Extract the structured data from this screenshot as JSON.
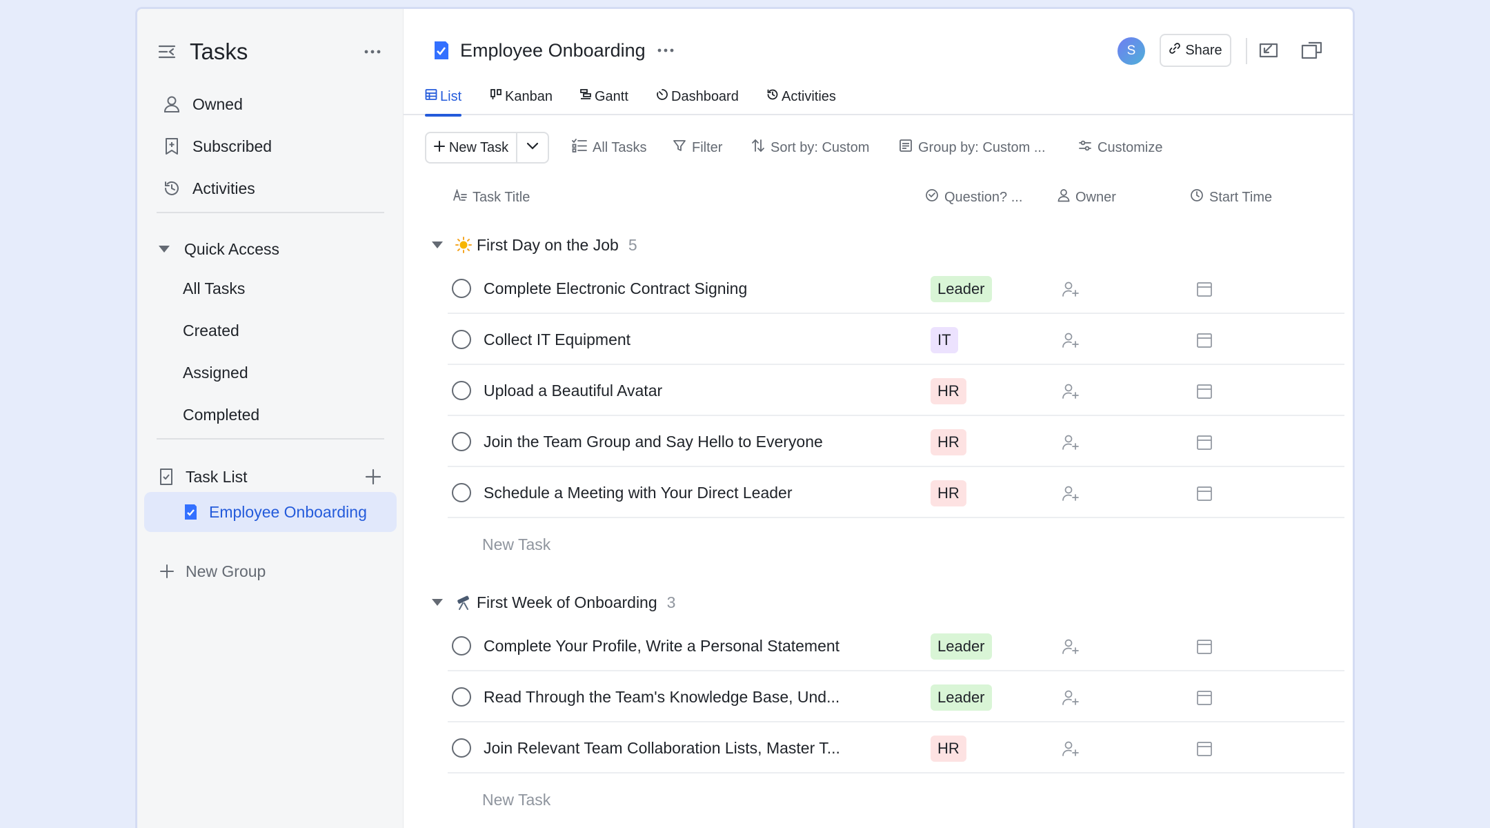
{
  "sidebar": {
    "title": "Tasks",
    "nav": [
      {
        "label": "Owned",
        "icon": "person-icon"
      },
      {
        "label": "Subscribed",
        "icon": "bookmark-icon"
      },
      {
        "label": "Activities",
        "icon": "history-icon"
      }
    ],
    "quick_access": {
      "label": "Quick Access",
      "items": [
        "All Tasks",
        "Created",
        "Assigned",
        "Completed"
      ]
    },
    "task_list": {
      "label": "Task List",
      "active_item": "Employee Onboarding"
    },
    "new_group_label": "New Group"
  },
  "header": {
    "title": "Employee Onboarding",
    "avatar_initial": "S",
    "share_label": "Share"
  },
  "tabs": [
    "List",
    "Kanban",
    "Gantt",
    "Dashboard",
    "Activities"
  ],
  "active_tab": "List",
  "toolbar": {
    "new_task_label": "New Task",
    "all_tasks_label": "All Tasks",
    "filter_label": "Filter",
    "sort_label": "Sort by: Custom",
    "group_label": "Group by: Custom ...",
    "customize_label": "Customize"
  },
  "columns": {
    "title": "Task Title",
    "question": "Question? ...",
    "owner": "Owner",
    "start": "Start Time"
  },
  "groups": [
    {
      "name": "First Day on the Job",
      "emoji": "sun",
      "count": "5",
      "tasks": [
        {
          "title": "Complete Electronic Contract Signing",
          "tag": "Leader",
          "tag_type": "leader"
        },
        {
          "title": "Collect IT Equipment",
          "tag": "IT",
          "tag_type": "it"
        },
        {
          "title": "Upload a Beautiful Avatar",
          "tag": "HR",
          "tag_type": "hr"
        },
        {
          "title": "Join the Team Group and Say Hello to Everyone",
          "tag": "HR",
          "tag_type": "hr"
        },
        {
          "title": "Schedule a Meeting with Your Direct Leader",
          "tag": "HR",
          "tag_type": "hr"
        }
      ],
      "new_task_label": "New Task"
    },
    {
      "name": "First Week of Onboarding",
      "emoji": "telescope",
      "count": "3",
      "tasks": [
        {
          "title": "Complete Your Profile, Write a Personal Statement",
          "tag": "Leader",
          "tag_type": "leader"
        },
        {
          "title": "Read Through the Team's Knowledge Base, Und...",
          "tag": "Leader",
          "tag_type": "leader"
        },
        {
          "title": "Join Relevant Team Collaboration Lists, Master T...",
          "tag": "HR",
          "tag_type": "hr"
        }
      ],
      "new_task_label": "New Task"
    }
  ],
  "colors": {
    "accent": "#245bdb",
    "leader_tag": "#d9f5d6",
    "it_tag": "#ece2fe",
    "hr_tag": "#fde2e2",
    "background": "#e6ecfb"
  }
}
